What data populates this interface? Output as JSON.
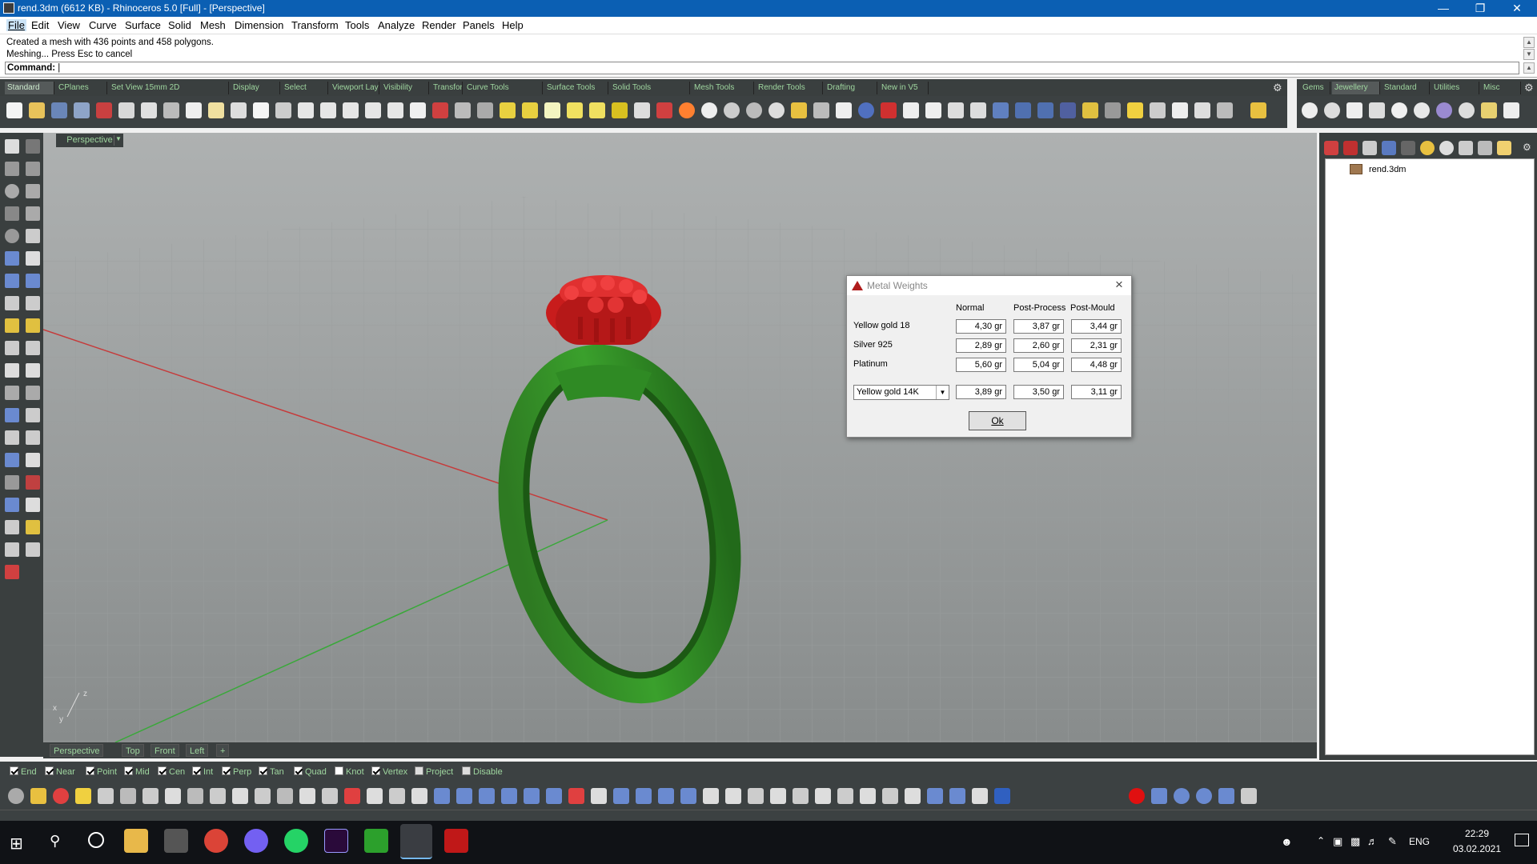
{
  "window": {
    "title": "rend.3dm (6612 KB) - Rhinoceros 5.0 [Full] - [Perspective]"
  },
  "menu": [
    "File",
    "Edit",
    "View",
    "Curve",
    "Surface",
    "Solid",
    "Mesh",
    "Dimension",
    "Transform",
    "Tools",
    "Analyze",
    "Render",
    "Panels",
    "Help"
  ],
  "command": {
    "history": [
      "Created a mesh with 436 points and 458 polygons.",
      "Meshing... Press Esc to cancel"
    ],
    "prompt_label": "Command:"
  },
  "toolbar_tabs": [
    "Standard",
    "CPlanes",
    "Set View 15mm 2D",
    "Display",
    "Select",
    "Viewport Layout",
    "Visibility",
    "Transform",
    "Curve Tools",
    "Surface Tools",
    "Solid Tools",
    "Mesh Tools",
    "Render Tools",
    "Drafting",
    "New in V5"
  ],
  "right_tabs": [
    "Gems",
    "Jewellery",
    "Standard",
    "Utilities",
    "Misc"
  ],
  "viewport": {
    "label": "Perspective",
    "tabs": [
      "Perspective",
      "Top",
      "Front",
      "Left",
      "+"
    ]
  },
  "osnap": [
    {
      "label": "End",
      "checked": true
    },
    {
      "label": "Near",
      "checked": true
    },
    {
      "label": "Point",
      "checked": true
    },
    {
      "label": "Mid",
      "checked": true
    },
    {
      "label": "Cen",
      "checked": true
    },
    {
      "label": "Int",
      "checked": true
    },
    {
      "label": "Perp",
      "checked": true
    },
    {
      "label": "Tan",
      "checked": true
    },
    {
      "label": "Quad",
      "checked": true
    },
    {
      "label": "Knot",
      "checked": false
    },
    {
      "label": "Vertex",
      "checked": true
    },
    {
      "label": "Project",
      "checked": false
    },
    {
      "label": "Disable",
      "checked": false
    }
  ],
  "layers_panel": {
    "file": "rend.3dm"
  },
  "dialog": {
    "title": "Metal Weights",
    "columns": [
      "Normal",
      "Post-Process",
      "Post-Mould"
    ],
    "rows": [
      {
        "label": "Yellow gold 18",
        "values": [
          "4,30 gr",
          "3,87 gr",
          "3,44 gr"
        ]
      },
      {
        "label": "Silver 925",
        "values": [
          "2,89 gr",
          "2,60 gr",
          "2,31 gr"
        ]
      },
      {
        "label": "Platinum",
        "values": [
          "5,60 gr",
          "5,04 gr",
          "4,48 gr"
        ]
      }
    ],
    "custom": {
      "selected": "Yellow gold 14K",
      "values": [
        "3,89 gr",
        "3,50 gr",
        "3,11 gr"
      ]
    },
    "ok_label": "Ok"
  },
  "taskbar": {
    "time": "22:29",
    "date": "03.02.2021",
    "lang": "ENG"
  }
}
